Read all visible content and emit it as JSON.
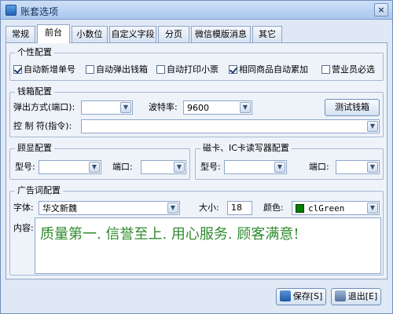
{
  "window": {
    "title": "账套选项",
    "close_label": "×"
  },
  "tabs": [
    {
      "label": "常规"
    },
    {
      "label": "前台"
    },
    {
      "label": "小数位"
    },
    {
      "label": "自定义字段"
    },
    {
      "label": "分页"
    },
    {
      "label": "微信模版消息"
    },
    {
      "label": "其它"
    }
  ],
  "personal": {
    "title": "个性配置",
    "options": [
      {
        "label": "自动新增单号",
        "checked": true
      },
      {
        "label": "自动弹出钱箱",
        "checked": false
      },
      {
        "label": "自动打印小票",
        "checked": false
      },
      {
        "label": "相同商品自动累加",
        "checked": true
      },
      {
        "label": "营业员必选",
        "checked": false
      }
    ]
  },
  "cashbox": {
    "title": "钱箱配置",
    "popup_label": "弹出方式(端口):",
    "popup_value": "",
    "baud_label": "波特率:",
    "baud_value": "9600",
    "test_button": "测试钱箱",
    "control_label": "控 制 符(指令):",
    "control_value": ""
  },
  "display": {
    "title": "顾显配置",
    "model_label": "型号:",
    "model_value": "",
    "port_label": "端口:",
    "port_value": ""
  },
  "cardreader": {
    "title": "磁卡、IC卡读写器配置",
    "model_label": "型号:",
    "model_value": "",
    "port_label": "端口:",
    "port_value": ""
  },
  "ad": {
    "title": "广告词配置",
    "font_label": "字体:",
    "font_value": "华文新魏",
    "size_label": "大小:",
    "size_value": "18",
    "color_label": "颜色:",
    "color_value": "clGreen",
    "color_hex": "#008000",
    "content_label": "内容:",
    "content_value": "质量第一. 信誉至上. 用心服务. 顾客满意!"
  },
  "footer": {
    "save_label": "保存[S]",
    "exit_label": "退出[E]"
  },
  "icons": {
    "dropdown": "chevron-down-icon",
    "save": "save-icon",
    "exit": "exit-icon"
  }
}
